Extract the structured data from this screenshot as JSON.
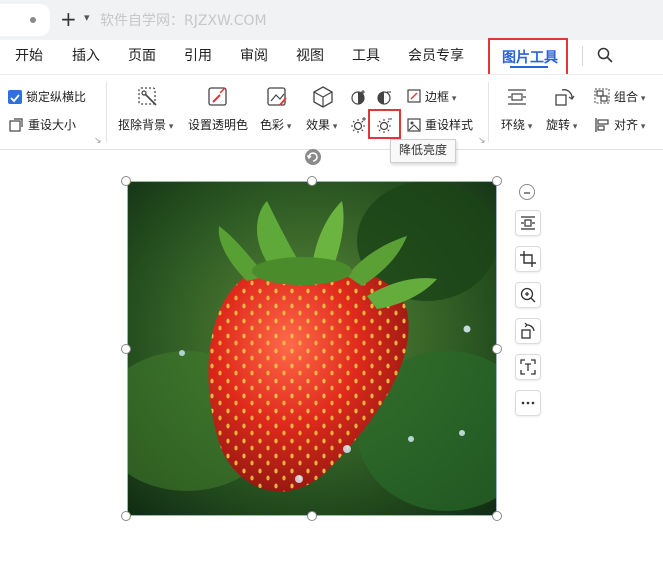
{
  "titlebar": {
    "plus": "+",
    "dropdown": "⌄",
    "watermark": "软件自学网：RJZXW.COM"
  },
  "menu": {
    "items": [
      "开始",
      "插入",
      "页面",
      "引用",
      "审阅",
      "视图",
      "工具",
      "会员专享"
    ],
    "active": "图片工具"
  },
  "toolbar": {
    "lock_ratio": "锁定纵横比",
    "resize": "重设大小",
    "remove_bg": "抠除背景",
    "set_transparent": "设置透明色",
    "color": "色彩",
    "effects": "效果",
    "border": "边框",
    "reset_style": "重设样式",
    "wrap": "环绕",
    "rotate": "旋转",
    "group": "组合",
    "align": "对齐"
  },
  "tooltip": {
    "text": "降低亮度"
  },
  "side_panel": {
    "icons": [
      "collapse-icon",
      "wrap-text-icon",
      "crop-icon",
      "zoom-icon",
      "rotate-icon",
      "ocr-icon",
      "more-icon"
    ]
  },
  "colors": {
    "accent_blue": "#2a62d8",
    "highlight_red": "#e0383a",
    "checkbox_blue": "#2f6fde"
  }
}
